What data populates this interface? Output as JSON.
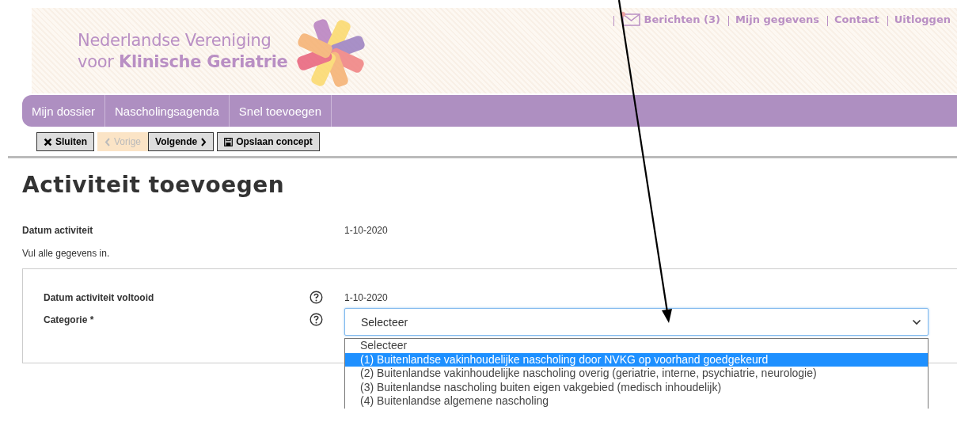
{
  "header": {
    "logo": {
      "line_1": "Nederlandse Vereniging",
      "line_2": "voor **Klinische Geriatrie**"
    },
    "top_links": [
      {
        "kind": "messages",
        "label": "Berichten (3)",
        "unread": true
      },
      {
        "kind": "link",
        "label": "Mijn gegevens"
      },
      {
        "kind": "link",
        "label": "Contact"
      },
      {
        "kind": "link",
        "label": "Uitloggen"
      }
    ]
  },
  "nav": {
    "items": [
      {
        "label": "Mijn dossier",
        "selected": false
      },
      {
        "label": "Nascholingsagenda",
        "selected": false
      },
      {
        "label": "Snel toevoegen",
        "selected": false
      }
    ]
  },
  "toolbar": {
    "buttons": [
      {
        "kind": "close",
        "label": "Sluiten",
        "disabled": false
      },
      {
        "kind": "prev",
        "label": "Vorige",
        "disabled": true
      },
      {
        "kind": "next",
        "label": "Volgende",
        "disabled": false
      },
      {
        "kind": "save",
        "label": "Opslaan concept",
        "disabled": false
      }
    ]
  },
  "title": "Activiteit toevoegen",
  "summary": {
    "label": "Datum activiteit",
    "value": "1-10-2020"
  },
  "instruction": "Vul alle gegevens in.",
  "form": {
    "fields": [
      {
        "kind": "text",
        "label": "Datum activiteit voltooid",
        "value": "1-10-2020"
      },
      {
        "kind": "select",
        "label": "Categorie *",
        "value": "Selecteer",
        "expanded": true,
        "options": [
          {
            "label": "Selecteer",
            "highlighted": false
          },
          {
            "label": "(1) Buitenlandse vakinhoudelijke nascholing door NVKG op voorhand goedgekeurd",
            "highlighted": true
          },
          {
            "label": "(2) Buitenlandse vakinhoudelijke nascholing overig (geriatrie, interne, psychiatrie, neurologie)",
            "highlighted": false
          },
          {
            "label": "(3) Buitenlandse nascholing buiten eigen vakgebied (medisch inhoudelijk)",
            "highlighted": false
          },
          {
            "label": "(4) Buitenlandse algemene nascholing",
            "highlighted": false
          }
        ]
      }
    ]
  }
}
